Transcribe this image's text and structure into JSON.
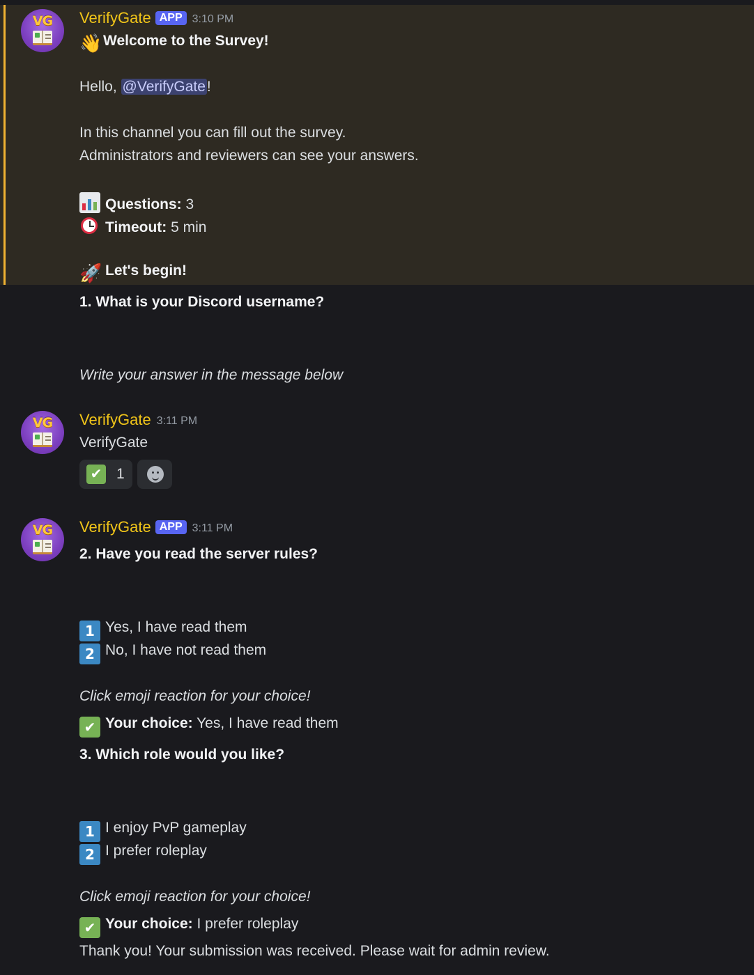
{
  "messages": [
    {
      "author": "VerifyGate",
      "badge": "APP",
      "timestamp": "3:10 PM",
      "title": "Welcome to the Survey!",
      "greeting_prefix": "Hello, ",
      "mention": "@VerifyGate",
      "greeting_suffix": "!",
      "line1": "In this channel you can fill out the survey.",
      "line2": "Administrators and reviewers can see your answers.",
      "questions_label": "Questions:",
      "questions_value": " 3",
      "timeout_label": "Timeout:",
      "timeout_value": " 5 min",
      "begin": "Let's begin!",
      "question1": "1. What is your Discord username?",
      "instruction": "Write your answer in the message below"
    },
    {
      "author": "VerifyGate",
      "timestamp": "3:11 PM",
      "text": "VerifyGate",
      "reaction_count": "1"
    },
    {
      "author": "VerifyGate",
      "badge": "APP",
      "timestamp": "3:11 PM",
      "question2": "2. Have you read the server rules?",
      "q2_options": [
        "Yes, I have read them",
        "No, I have not read them"
      ],
      "q2_instruction": "Click emoji reaction for your choice!",
      "choice_label": "Your choice:",
      "q2_choice": " Yes, I have read them",
      "question3": "3. Which role would you like?",
      "q3_options": [
        "I enjoy PvP gameplay",
        "I prefer roleplay"
      ],
      "q3_instruction": "Click emoji reaction for your choice!",
      "q3_choice": " I prefer roleplay",
      "thanks": "Thank you! Your submission was received. Please wait for admin review."
    }
  ],
  "icons": {
    "wave": "waving-hand-emoji",
    "chart": "bar-chart-emoji",
    "clock": "alarm-clock-emoji",
    "rocket": "rocket-emoji",
    "check": "check-mark-button-emoji",
    "num1": "1",
    "num2": "2"
  },
  "colors": {
    "username": "#f0c419",
    "app_badge": "#5865f2",
    "highlight_bg": "#2e2a22",
    "highlight_bar": "#f0b232",
    "background": "#1a1a1e"
  }
}
